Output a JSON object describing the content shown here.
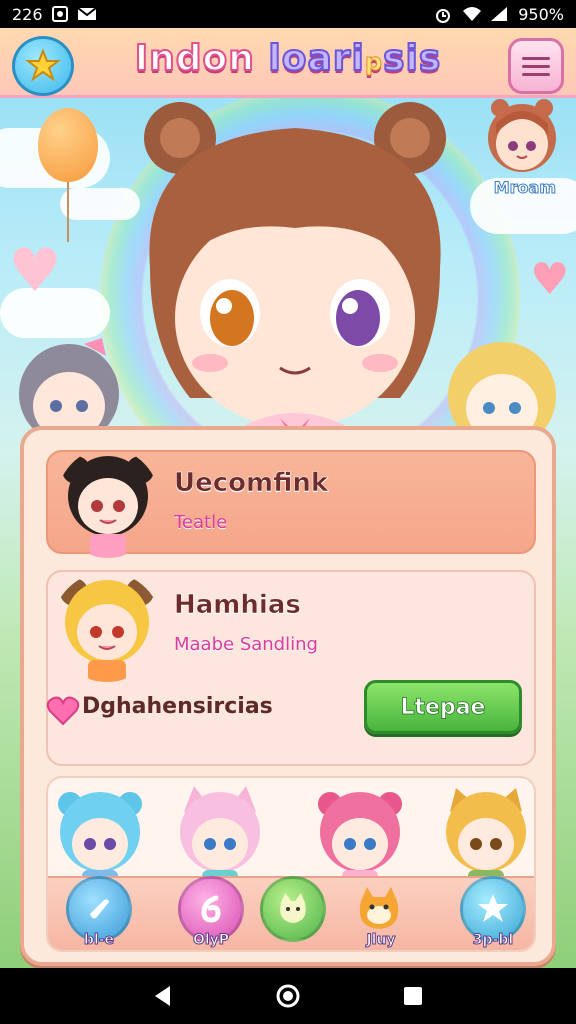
{
  "status_bar": {
    "time": "226",
    "battery": "950%"
  },
  "header": {
    "title_part1": "Indon ",
    "title_part2": "loari",
    "title_part3": "p",
    "title_part4": "sis"
  },
  "corner_npc": {
    "label": "Mroam"
  },
  "cards": [
    {
      "title": "Uecomfink",
      "subtitle": "Teatle"
    },
    {
      "title": "Hamhias",
      "subtitle": "Maabe Sandling"
    }
  ],
  "stat": {
    "label": "Dghahensircias"
  },
  "upgrade_button": {
    "label": "Ltepae"
  },
  "bottom_nav": [
    {
      "label": "bl-e",
      "icon": "hand-icon"
    },
    {
      "label": "OlyP",
      "icon": "number-six-icon"
    },
    {
      "label": "",
      "icon": "cat-face-icon"
    },
    {
      "label": "Jluy",
      "icon": "pet-icon"
    },
    {
      "label": "3p-bl",
      "icon": "star-icon"
    }
  ],
  "colors": {
    "accent_pink": "#e0508f",
    "panel_bg": "#fde8dc",
    "card_active": "#f5a68a",
    "upgrade_green": "#48b43c"
  }
}
